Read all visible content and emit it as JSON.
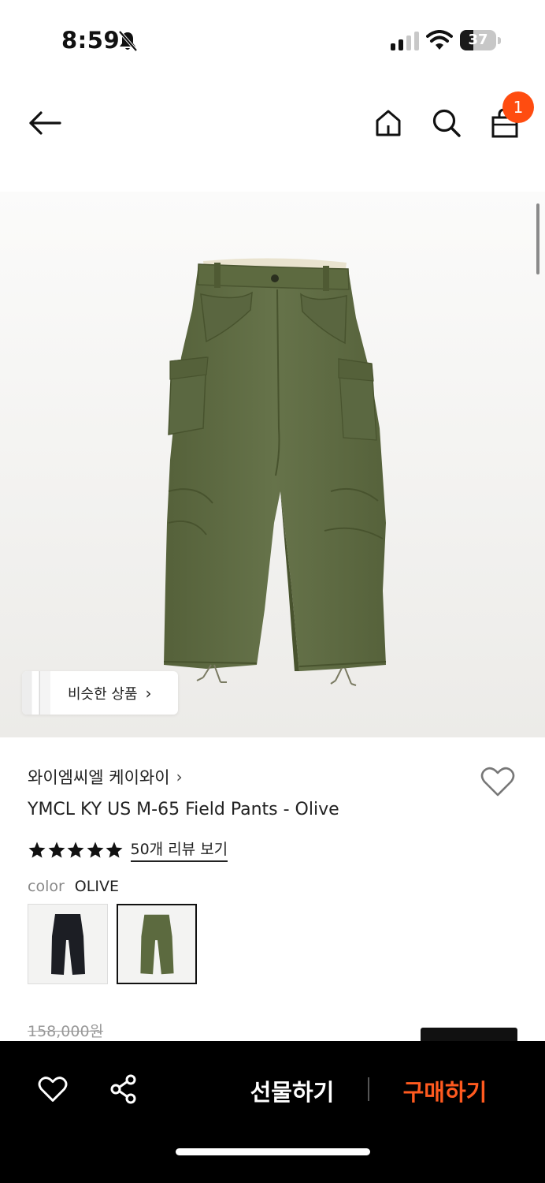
{
  "status_bar": {
    "time": "8:59",
    "battery": "37",
    "battery_level": 0.37
  },
  "nav": {
    "cart_count": "1"
  },
  "product": {
    "similar_label": "비슷한 상품",
    "brand": "와이엠씨엘 케이와이",
    "title": "YMCL KY US M-65 Field Pants - Olive",
    "rating": 5,
    "review_link": "50개 리뷰 보기",
    "color_label": "color",
    "color_value": "OLIVE",
    "swatches": [
      {
        "name": "black",
        "color": "#1c1e24",
        "selected": false
      },
      {
        "name": "olive",
        "color": "#5c6a3f",
        "selected": true
      }
    ],
    "original_price": "158,000원"
  },
  "bottom_bar": {
    "gift_label": "선물하기",
    "buy_label": "구매하기"
  },
  "colors": {
    "accent": "#ff4c10",
    "buy_text": "#ff5a1f",
    "olive_pants": "#5f6b40",
    "bottom_bar": "#000000"
  },
  "icons": {
    "back": "arrow-left-icon",
    "home": "home-icon",
    "search": "search-icon",
    "bag": "shopping-bag-icon",
    "wish": "heart-outline-icon",
    "share": "share-icon"
  }
}
